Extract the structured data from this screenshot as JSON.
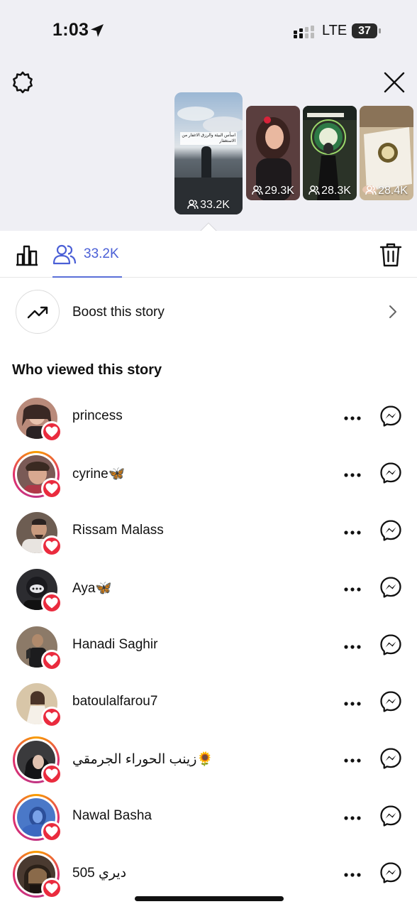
{
  "status_bar": {
    "time": "1:03",
    "network": "LTE",
    "battery": "37"
  },
  "icons": {
    "settings": "gear-icon",
    "close": "close-icon",
    "insights": "bar-chart-icon",
    "viewers": "people-icon",
    "delete": "trash-icon",
    "boost": "trending-up-icon",
    "chevron": "chevron-right-icon",
    "more": "more-horizontal-icon",
    "message": "messenger-icon",
    "like": "heart-icon"
  },
  "stories": [
    {
      "count": "33.2K",
      "selected": true,
      "caption": "اسأس البيئة والرزق الاغفار من الاستغفار",
      "bg": "#6f7c86"
    },
    {
      "count": "29.3K",
      "selected": false,
      "bg": "#3a2a2e"
    },
    {
      "count": "28.3K",
      "selected": false,
      "bg": "#2f3a2e"
    },
    {
      "count": "28.4K",
      "selected": false,
      "bg": "#b9a48a"
    }
  ],
  "tabs": {
    "viewers_count": "33.2K"
  },
  "boost": {
    "label": "Boost this story"
  },
  "section_title": "Who viewed this story",
  "viewers": [
    {
      "name": "princess",
      "ring": false,
      "avatar_bg": "#b98a7a"
    },
    {
      "name": "cyrine🦋",
      "ring": true,
      "avatar_bg": "#7a5a56"
    },
    {
      "name": "Rissam Malass",
      "ring": false,
      "avatar_bg": "#6d5d52"
    },
    {
      "name": "Aya🦋",
      "ring": false,
      "avatar_bg": "#2c2c30"
    },
    {
      "name": "Hanadi Saghir",
      "ring": false,
      "avatar_bg": "#8c7a68"
    },
    {
      "name": "batoulalfarou7",
      "ring": false,
      "avatar_bg": "#d8c6a8"
    },
    {
      "name": "زينب الحوراء الجرمقي🌻",
      "ring": true,
      "avatar_bg": "#3a3a3c"
    },
    {
      "name": "Nawal Basha",
      "ring": true,
      "avatar_bg": "#4a78c8"
    },
    {
      "name": "ديري 505",
      "ring": true,
      "avatar_bg": "#4a3a30"
    }
  ],
  "colors": {
    "accent": "#4a5fd6",
    "heart": "#ea2b3e",
    "top_bg": "#efeff4"
  }
}
